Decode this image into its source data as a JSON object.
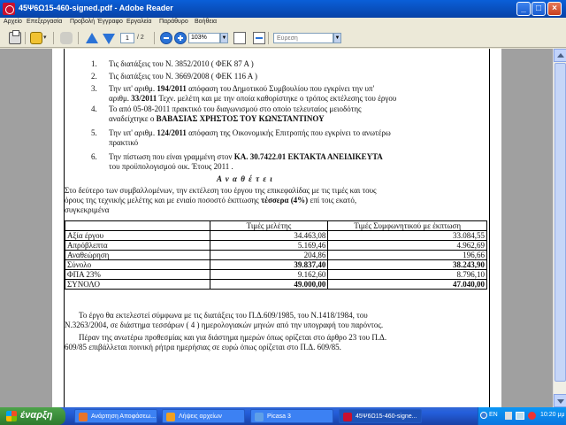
{
  "window": {
    "title": "45Ψ6Ω15-460-signed.pdf - Adobe Reader"
  },
  "menu": [
    "Αρχείο",
    "Επεξεργασία",
    "Προβολή",
    "Έγγραφο",
    "Εργαλεία",
    "Παράθυρο",
    "Βοήθεια"
  ],
  "toolbar": {
    "page_current": "1",
    "page_total": "/ 2",
    "zoom": "103%",
    "search_placeholder": "Εύρεση"
  },
  "doc": {
    "items": [
      {
        "num": "1.",
        "text": "Τις διατάξεις του Ν. 3852/2010 ( ΦΕΚ 87  Α )"
      },
      {
        "num": "2.",
        "text": "Τις διατάξεις του Ν. 3669/2008 ( ΦΕΚ 116 Α )"
      },
      {
        "num": "3.",
        "pre": "Την υπ' αριθμ. ",
        "bold": "194/2011",
        "post": " απόφαση του Δημοτικού Συμβουλίου που εγκρίνει την υπ'"
      },
      {
        "num": "",
        "pre": "αριθμ. ",
        "bold": "33/2011",
        "post": " Τεχν. μελέτη και με την οποία καθορίστηκε ο τρόπος εκτέλεσης του έργου"
      },
      {
        "num": "4.",
        "text": "Το από 05-08-2011 πρακτικό του διαγωνισμού στο οποίο τελευταίος μειοδότης"
      },
      {
        "num": "",
        "pre": "αναδείχτηκε ο ",
        "bold": "ΒΑΒΑΣΙΑΣ ΧΡΗΣΤΟΣ ΤΟΥ ΚΩΝΣΤΑΝΤΙΝΟΥ",
        "post": ""
      },
      {
        "num": "5.",
        "pre": " Την υπ' αριθμ. ",
        "bold": "124/2011",
        "post": " απόφαση της Οικονομικής  Επιτροπής που εγκρίνει το ανωτέρω"
      },
      {
        "num": "",
        "text": "πρακτικό"
      },
      {
        "num": "6.",
        "pre": "Την πίστωση που είναι γραμμένη στον ",
        "bold": "ΚΑ. 30.7422.01 ΕΚΤΑΚΤΑ ΑΝΕΙΔΙΚΕΥΤΑ",
        "post": ""
      },
      {
        "num": "",
        "text": "του προϋπολογισμού οικ. Έτους 2011 ."
      }
    ],
    "heading": "Α ν α θ έ τ ε ι",
    "intro_1": "Στο δεύτερο των συμβαλλομένων, την εκτέλεση του έργου της επικεφαλίδας με τις τιμές και τους",
    "intro_2_pre": "όρους της τεχνικής μελέτης και με ενιαίο ποσοστό έκπτωσης ",
    "intro_2_bold": "τέσσερα  (4%)",
    "intro_2_post": "  επί τοις εκατό,",
    "intro_3": "συγκεκριμένα",
    "table": {
      "headers": [
        "",
        "Τιμές μελέτης",
        "Τιμές Συμφωνητικού με έκπτωση"
      ],
      "rows": [
        [
          "Αξία έργου",
          "34.463,08",
          "33.084,55"
        ],
        [
          "Απρόβλεπτα",
          "5.169,46",
          "4.962,69"
        ],
        [
          "Αναθεώρηση",
          "204,86",
          "196,66"
        ],
        [
          "Σύνολο",
          "39.837,40",
          "38.243,90"
        ],
        [
          "ΦΠΑ 23%",
          "9.162,60",
          "8.796,10"
        ],
        [
          "ΣΥΝΟΛΟ",
          "49.000,00",
          "47.040,00"
        ]
      ]
    },
    "para_1a": "Το έργο θα εκτελεστεί σύμφωνα με τις διατάξεις του Π.Δ.609/1985, του Ν.1418/1984, του",
    "para_1b": "Ν.3263/2004, σε διάστημα  τεσσάρων ( 4 ) ημερολογιακών μηνών από την υπογραφή του παρόντος.",
    "para_2a": "Πέραν της ανωτέρω προθεσμίας και για διάστημα ημερών όπως ορίζεται στο άρθρο 23 του Π.Δ.",
    "para_2b": "609/85 επιβάλλεται ποινική ρήτρα ημερήσιας σε ευρώ όπως ορίζεται στο Π.Δ. 609/85."
  },
  "taskbar": {
    "start": "έναρξη",
    "tasks": [
      {
        "label": "Ανάρτηση Αποφάσεω...",
        "color": "#e8742a"
      },
      {
        "label": "Λήψεις αρχείων",
        "color": "#f0a020"
      },
      {
        "label": "Picasa 3",
        "color": "#5fa0e8"
      },
      {
        "label": "45Ψ6Ω15-460-signe...",
        "color": "#c8102e"
      }
    ],
    "lang": "EN",
    "clock": "10:20 μμ"
  }
}
